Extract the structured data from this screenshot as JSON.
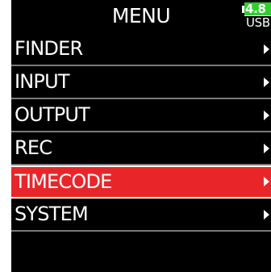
{
  "header": {
    "title": "MENU",
    "battery_value": "4.8",
    "power_source": "USB",
    "battery_color": "#2fcf2f"
  },
  "colors": {
    "background": "#000000",
    "highlight": "#e8262a",
    "divider": "#7a7a7a",
    "text": "#ffffff"
  },
  "menu": {
    "selected_index": 4,
    "items": [
      {
        "label": "FINDER",
        "icon": "play-arrow-icon"
      },
      {
        "label": "INPUT",
        "icon": "play-arrow-icon"
      },
      {
        "label": "OUTPUT",
        "icon": "play-arrow-icon"
      },
      {
        "label": "REC",
        "icon": "play-arrow-icon"
      },
      {
        "label": "TIMECODE",
        "icon": "play-arrow-icon"
      },
      {
        "label": "SYSTEM",
        "icon": "play-arrow-icon"
      }
    ]
  }
}
